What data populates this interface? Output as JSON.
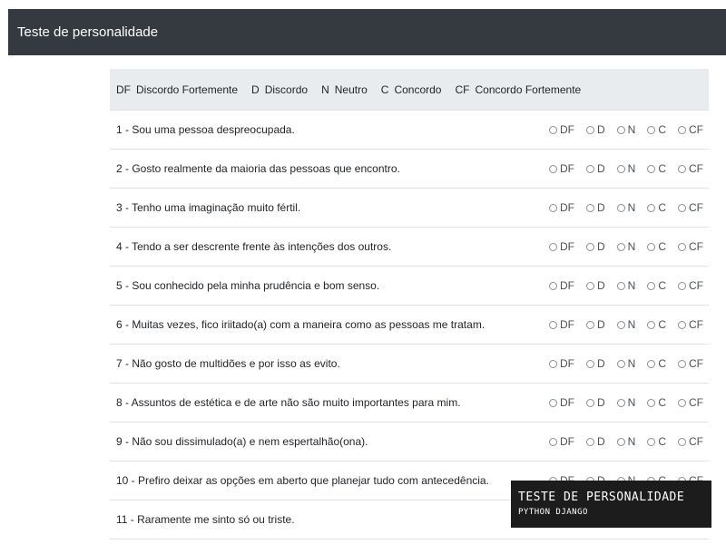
{
  "navbar": {
    "title": "Teste de personalidade"
  },
  "legend": [
    {
      "abbr": "DF",
      "label": "Discordo Fortemente"
    },
    {
      "abbr": "D",
      "label": "Discordo"
    },
    {
      "abbr": "N",
      "label": "Neutro"
    },
    {
      "abbr": "C",
      "label": "Concordo"
    },
    {
      "abbr": "CF",
      "label": "Concordo Fortemente"
    }
  ],
  "options": [
    "DF",
    "D",
    "N",
    "C",
    "CF"
  ],
  "questions": [
    "1 - Sou uma pessoa despreocupada.",
    "2 - Gosto realmente da maioria das pessoas que encontro.",
    "3 - Tenho uma imaginação muito fértil.",
    "4 - Tendo a ser descrente frente às intenções dos outros.",
    "5 - Sou conhecido pela minha prudência e bom senso.",
    "6 - Muitas vezes, fico iriitado(a) com a maneira como as pessoas me tratam.",
    "7 - Não gosto de multidões e por isso as evito.",
    "8 - Assuntos de estética e de arte não são muito importantes para mim.",
    "9 - Não sou dissimulado(a) e nem espertalhão(ona).",
    "10 - Prefiro deixar as opções em aberto que planejar tudo com antecedência.",
    "11 - Raramente me sinto só ou triste."
  ],
  "overlay": {
    "title": "TESTE DE PERSONALIDADE",
    "subtitle": "PYTHON  DJANGO"
  }
}
